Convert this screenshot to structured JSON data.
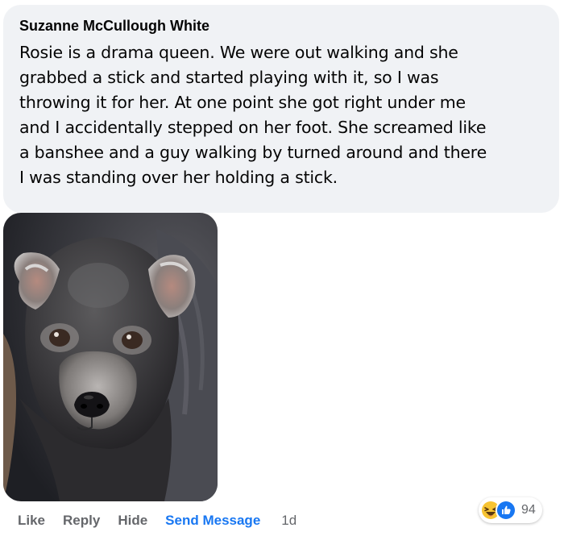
{
  "comment": {
    "author": "Suzanne McCullough White",
    "text": "Rosie is a drama queen. We were out walking and she\ngrabbed a stick and started playing with it, so I was\nthrowing it for her. At one point she got right under me\nand I accidentally stepped on her foot. She screamed like\na banshee and a guy walking by turned around and there\nI was standing over her holding a stick."
  },
  "actions": {
    "like": "Like",
    "reply": "Reply",
    "hide": "Hide",
    "send_message": "Send Message",
    "time": "1d"
  },
  "reactions": {
    "icons": [
      "haha-icon",
      "like-icon"
    ],
    "count": "94"
  },
  "colors": {
    "bubble_bg": "#f0f2f5",
    "action_text": "#65676b",
    "link_blue": "#1877f2"
  }
}
